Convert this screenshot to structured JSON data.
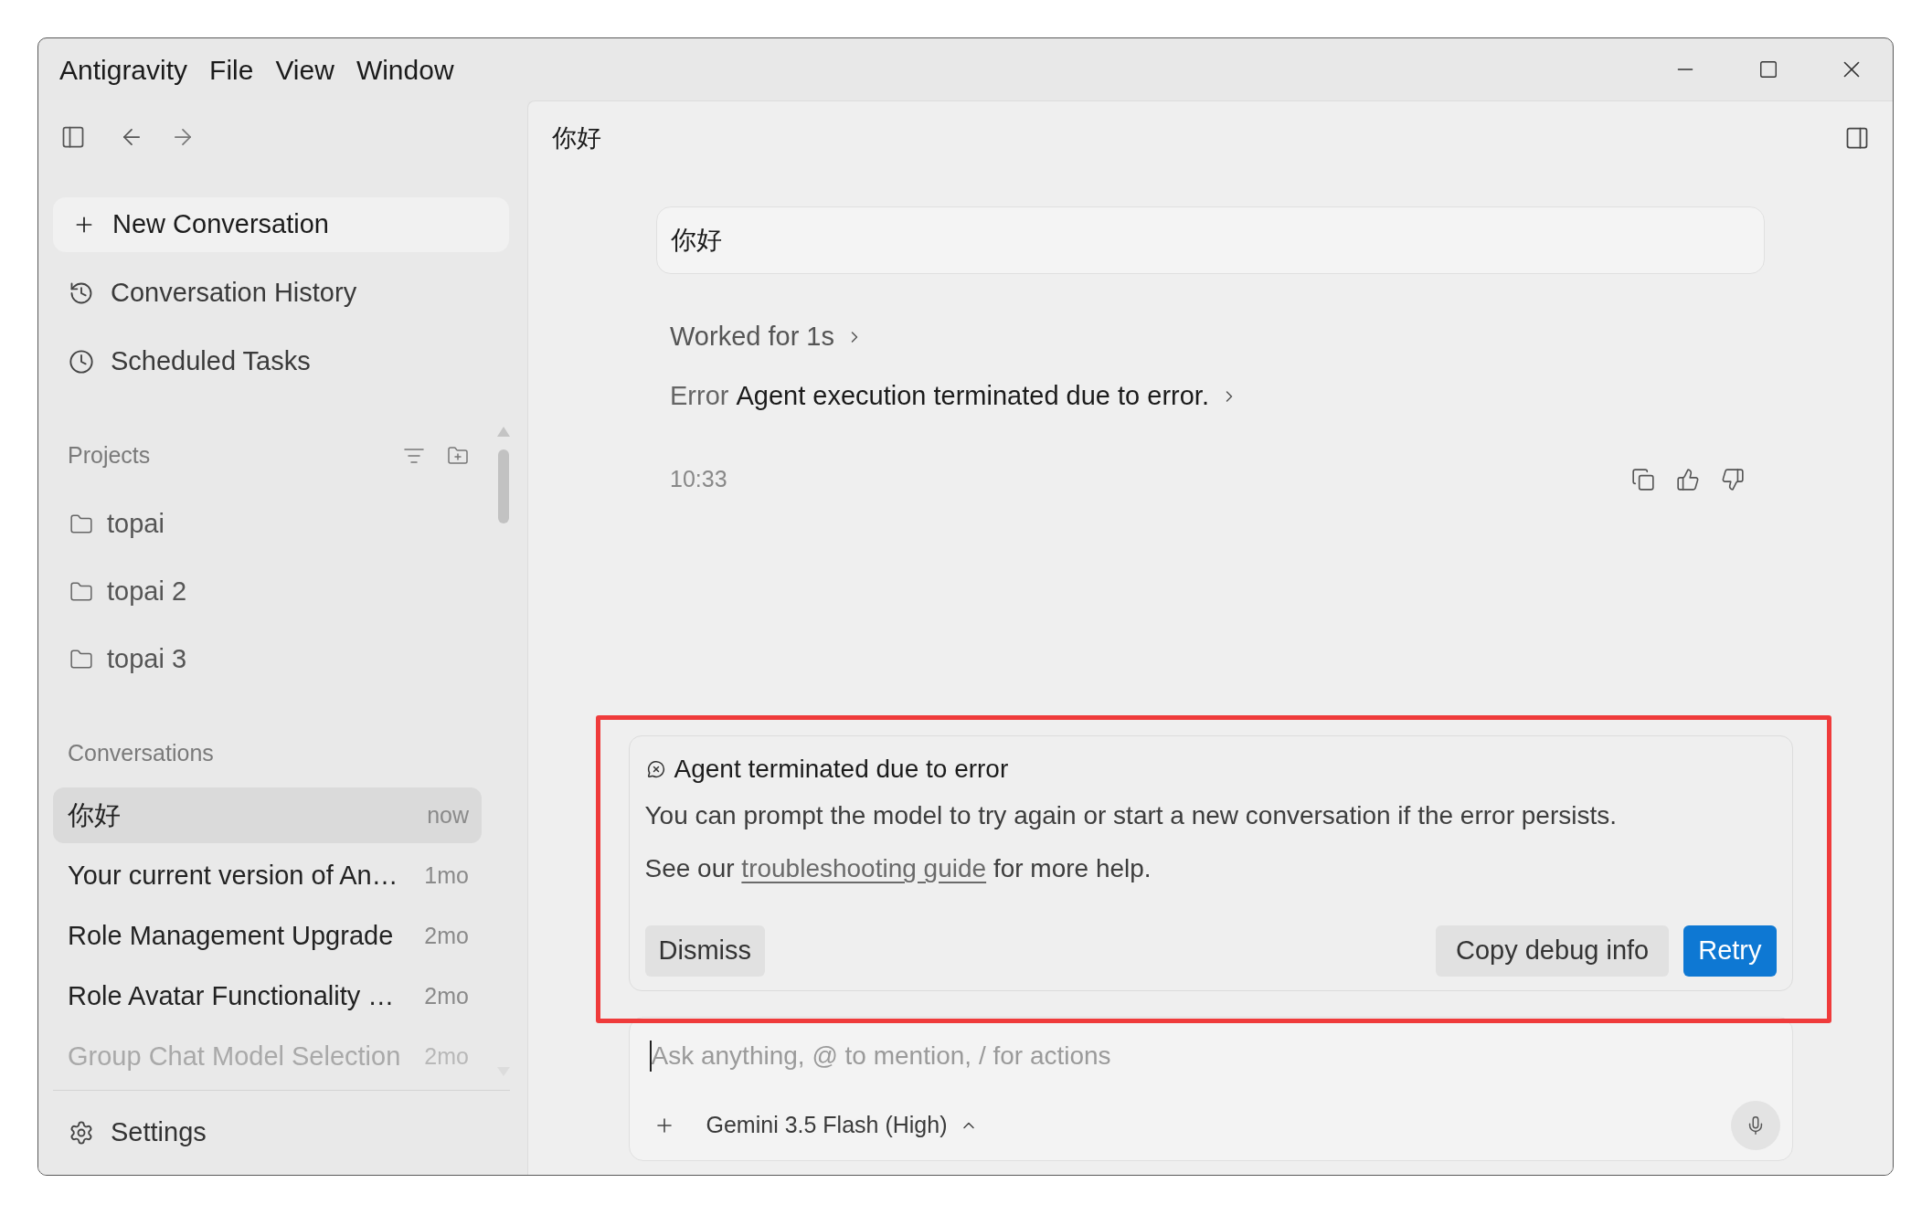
{
  "window": {
    "menu": [
      "Antigravity",
      "File",
      "View",
      "Window"
    ]
  },
  "sidebar": {
    "new_conversation": "New Conversation",
    "conversation_history": "Conversation History",
    "scheduled_tasks": "Scheduled Tasks",
    "projects": {
      "label": "Projects",
      "items": [
        "topai",
        "topai 2",
        "topai 3"
      ]
    },
    "conversations": {
      "label": "Conversations",
      "items": [
        {
          "title": "你好",
          "time": "now",
          "selected": true
        },
        {
          "title": "Your current version of An…",
          "time": "1mo",
          "selected": false
        },
        {
          "title": "Role Management Upgrade",
          "time": "2mo",
          "selected": false
        },
        {
          "title": "Role Avatar Functionality …",
          "time": "2mo",
          "selected": false
        },
        {
          "title": "Group Chat Model Selection",
          "time": "2mo",
          "selected": false
        }
      ]
    },
    "settings": "Settings"
  },
  "main": {
    "title": "你好",
    "user_message": "你好",
    "worked": "Worked for 1s",
    "error": {
      "label": "Error",
      "text": "Agent execution terminated due to error."
    },
    "time": "10:33"
  },
  "error_card": {
    "title": "Agent terminated due to error",
    "message": "You can prompt the model to try again or start a new conversation if the error persists.",
    "help": {
      "before": "See our",
      "link": "troubleshooting guide",
      "after": "for more help."
    },
    "dismiss": "Dismiss",
    "actions": [
      {
        "label": "Copy debug info",
        "kind": "secondary"
      },
      {
        "label": "Retry",
        "kind": "primary"
      }
    ]
  },
  "composer": {
    "placeholder": "Ask anything, @ to mention, / for actions",
    "model": "Gemini 3.5 Flash (High)"
  }
}
